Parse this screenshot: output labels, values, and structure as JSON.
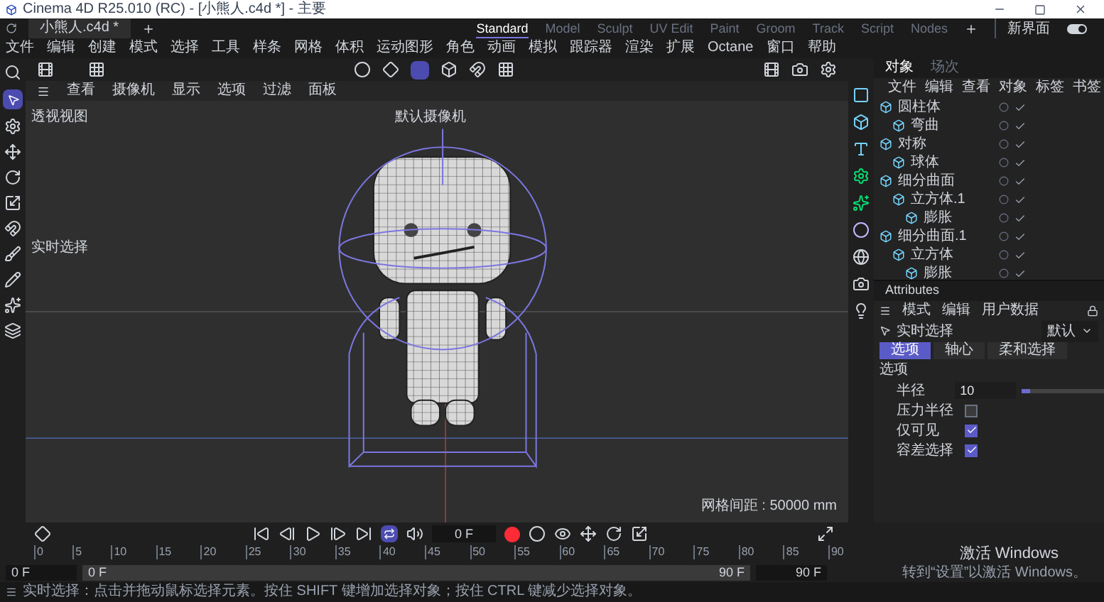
{
  "window": {
    "title": "Cinema 4D R25.010 (RC) - [小熊人.c4d *] - 主要"
  },
  "document_tab": {
    "label": "小熊人.c4d *"
  },
  "menu": [
    "文件",
    "编辑",
    "创建",
    "模式",
    "选择",
    "工具",
    "样条",
    "网格",
    "体积",
    "运动图形",
    "角色",
    "动画",
    "模拟",
    "跟踪器",
    "渲染",
    "扩展",
    "Octane",
    "窗口",
    "帮助"
  ],
  "layouts": [
    {
      "label": "Standard",
      "selected": true
    },
    {
      "label": "Model",
      "selected": false
    },
    {
      "label": "Sculpt",
      "selected": false
    },
    {
      "label": "UV Edit",
      "selected": false
    },
    {
      "label": "Paint",
      "selected": false
    },
    {
      "label": "Groom",
      "selected": false
    },
    {
      "label": "Track",
      "selected": false
    },
    {
      "label": "Script",
      "selected": false
    },
    {
      "label": "Nodes",
      "selected": false
    }
  ],
  "new_layout": "新界面",
  "theme_toggle": {
    "on": true
  },
  "viewport": {
    "menu": [
      "查看",
      "摄像机",
      "显示",
      "选项",
      "过滤",
      "面板"
    ],
    "view_name": "透视视图",
    "camera": "默认摄像机",
    "tool_hint": "实时选择",
    "grid_spacing": "网格间距 : 50000 mm"
  },
  "objects": {
    "tabs": [
      {
        "label": "对象",
        "selected": true
      },
      {
        "label": "场次",
        "selected": false
      }
    ],
    "menu": [
      "文件",
      "编辑",
      "查看",
      "对象",
      "标签",
      "书签"
    ],
    "tree": [
      {
        "name": "圆柱体",
        "children": [
          {
            "name": "弯曲"
          }
        ]
      },
      {
        "name": "对称",
        "children": [
          {
            "name": "球体"
          }
        ]
      },
      {
        "name": "细分曲面",
        "children": [
          {
            "name": "立方体.1",
            "children": [
              {
                "name": "膨胀"
              }
            ]
          }
        ]
      },
      {
        "name": "细分曲面.1",
        "children": [
          {
            "name": "立方体",
            "children": [
              {
                "name": "膨胀"
              }
            ]
          }
        ]
      }
    ]
  },
  "attributes": {
    "title": "Attributes",
    "menu": [
      "模式",
      "编辑",
      "用户数据"
    ],
    "tool": "实时选择",
    "preset": "默认",
    "tabs": [
      {
        "label": "选项",
        "selected": true
      },
      {
        "label": "轴心",
        "selected": false
      },
      {
        "label": "柔和选择",
        "selected": false
      }
    ],
    "section": "选项",
    "fields": [
      {
        "kind": "number",
        "label": "半径",
        "value": "10",
        "level": 0.1
      },
      {
        "kind": "checkbox",
        "label": "压力半径",
        "checked": false
      },
      {
        "kind": "checkbox",
        "label": "仅可见",
        "checked": true
      },
      {
        "kind": "checkbox",
        "label": "容差选择",
        "checked": true
      }
    ]
  },
  "timeline": {
    "frame": "0 F",
    "ticks": [
      "0",
      "5",
      "10",
      "15",
      "20",
      "25",
      "30",
      "35",
      "40",
      "45",
      "50",
      "55",
      "60",
      "65",
      "70",
      "75",
      "80",
      "85",
      "90"
    ],
    "start": "0 F",
    "range_start": "0 F",
    "range_end": "90 F",
    "end": "90 F"
  },
  "status_bar": "实时选择：点击并拖动鼠标选择元素。按住 SHIFT 键增加选择对象；按住 CTRL 键减少选择对象。",
  "activation": {
    "title": "激活 Windows",
    "hint": "转到“设置”以激活 Windows。"
  }
}
